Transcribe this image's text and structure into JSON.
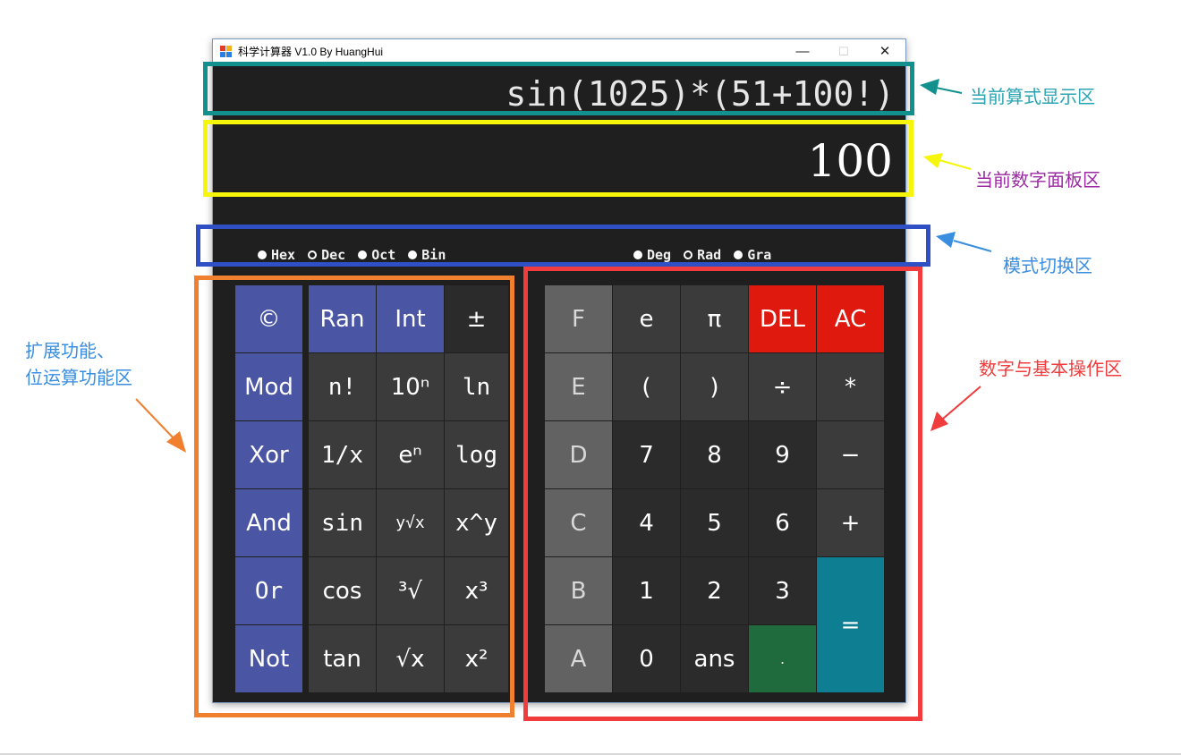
{
  "window": {
    "title": "科学计算器 V1.0  By HuangHui",
    "min_icon": "minimize-icon",
    "max_icon": "maximize-icon",
    "close_icon": "close-icon"
  },
  "display": {
    "expression": "sin(1025)*(51+100!)",
    "number": "100"
  },
  "modes": {
    "base": [
      {
        "label": "Hex",
        "selected": true
      },
      {
        "label": "Dec",
        "selected": false
      },
      {
        "label": "Oct",
        "selected": true
      },
      {
        "label": "Bin",
        "selected": true
      }
    ],
    "angle": [
      {
        "label": "Deg",
        "selected": true
      },
      {
        "label": "Rad",
        "selected": false
      },
      {
        "label": "Gra",
        "selected": true
      }
    ]
  },
  "keys": {
    "copyright": "©",
    "ran": "Ran",
    "int": "Int",
    "plusminus": "±",
    "mod": "Mod",
    "fact": "n!",
    "pow10": "10ⁿ",
    "ln": "ln",
    "xor": "Xor",
    "recip": "1/x",
    "exp": "eⁿ",
    "log": "log",
    "and": "And",
    "sin": "sin",
    "yroot": "y√x",
    "xpowy": "x^y",
    "or": "Or",
    "cos": "cos",
    "cuberoot": "³√",
    "cube": "x³",
    "not": "Not",
    "tan": "tan",
    "sqrt": "√x",
    "square": "x²",
    "F": "F",
    "e": "e",
    "pi": "π",
    "del": "DEL",
    "ac": "AC",
    "E": "E",
    "lparen": "(",
    "rparen": ")",
    "div": "÷",
    "mul": "*",
    "D": "D",
    "n7": "7",
    "n8": "8",
    "n9": "9",
    "minus": "−",
    "C": "C",
    "n4": "4",
    "n5": "5",
    "n6": "6",
    "plus": "+",
    "B": "B",
    "n1": "1",
    "n2": "2",
    "n3": "3",
    "equals": "=",
    "A": "A",
    "n0": "0",
    "ans": "ans",
    "dot": "."
  },
  "annotations": {
    "expr": "当前算式显示区",
    "number": "当前数字面板区",
    "mode": "模式切换区",
    "ext_line1": "扩展功能、",
    "ext_line2": "位运算功能区",
    "basic": "数字与基本操作区"
  },
  "colors": {
    "expr_box": "#12908e",
    "number_box": "#f6f60a",
    "mode_box": "#2f4fc4",
    "ext_box": "#f07f2f",
    "basic_box": "#f03c3c",
    "expr_text": "#2aa4b2",
    "number_text": "#9b2aa2",
    "mode_text": "#3a8ee0",
    "ext_text": "#3a8ee0",
    "basic_text": "#f03c3c"
  }
}
